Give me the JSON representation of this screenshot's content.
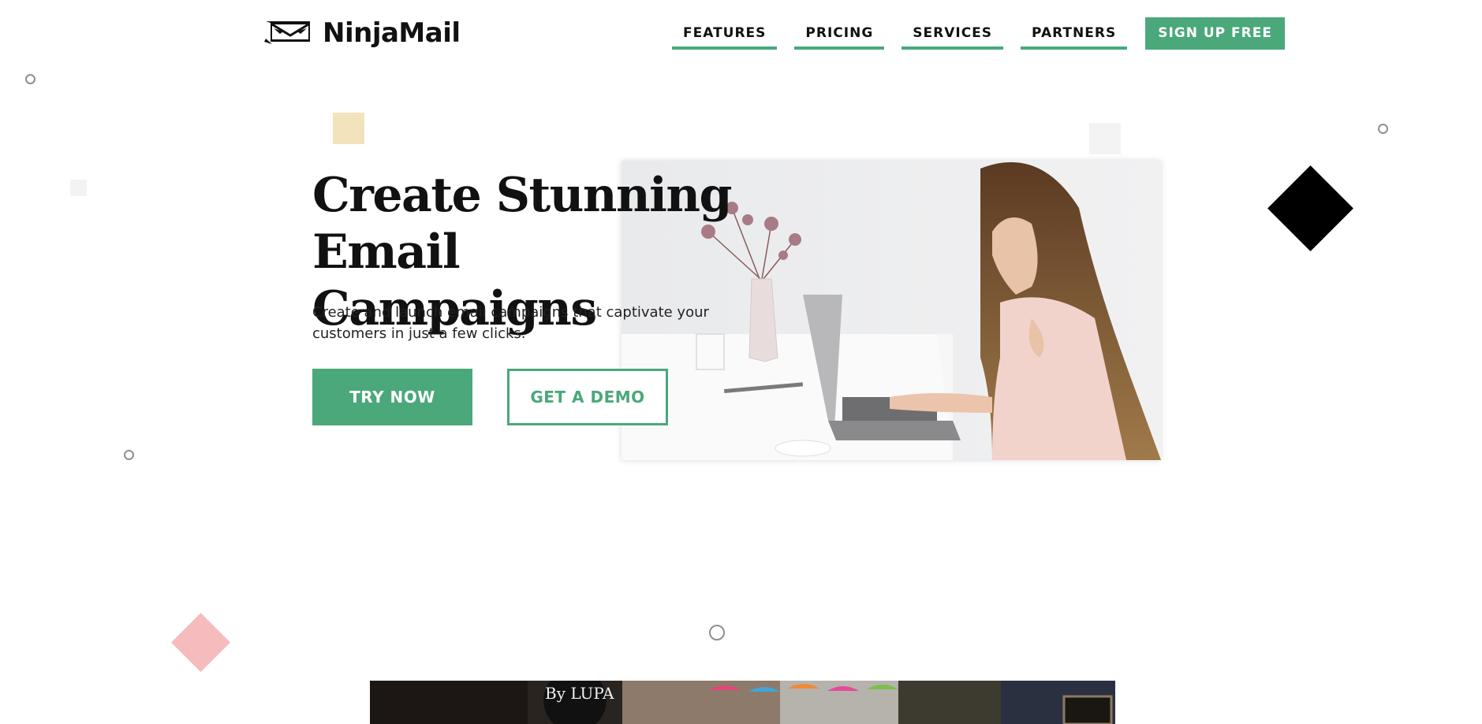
{
  "brand": {
    "name": "NinjaMail",
    "icon": "ninja-mask-envelope-icon",
    "accent": "#4aa87a"
  },
  "nav": {
    "items": [
      {
        "label": "FEATURES"
      },
      {
        "label": "PRICING"
      },
      {
        "label": "SERVICES"
      },
      {
        "label": "PARTNERS"
      }
    ],
    "cta": "SIGN UP FREE"
  },
  "hero": {
    "title_line1": "Create Stunning",
    "title_line2": "Email Campaigns",
    "subtitle": "Create and launch email campaigns that captivate your customers in just a few clicks.",
    "primary_button": "TRY NOW",
    "secondary_button": "GET A DEMO",
    "image": "woman-typing-on-laptop-photo"
  },
  "lower_section": {
    "image": "street-with-colorful-umbrellas-photo",
    "image_text": "By LUPA"
  },
  "decor_colors": {
    "cream": "#f2e3bd",
    "light_gray": "#f3f3f3",
    "pink": "#f6bcbd",
    "black": "#000000"
  }
}
